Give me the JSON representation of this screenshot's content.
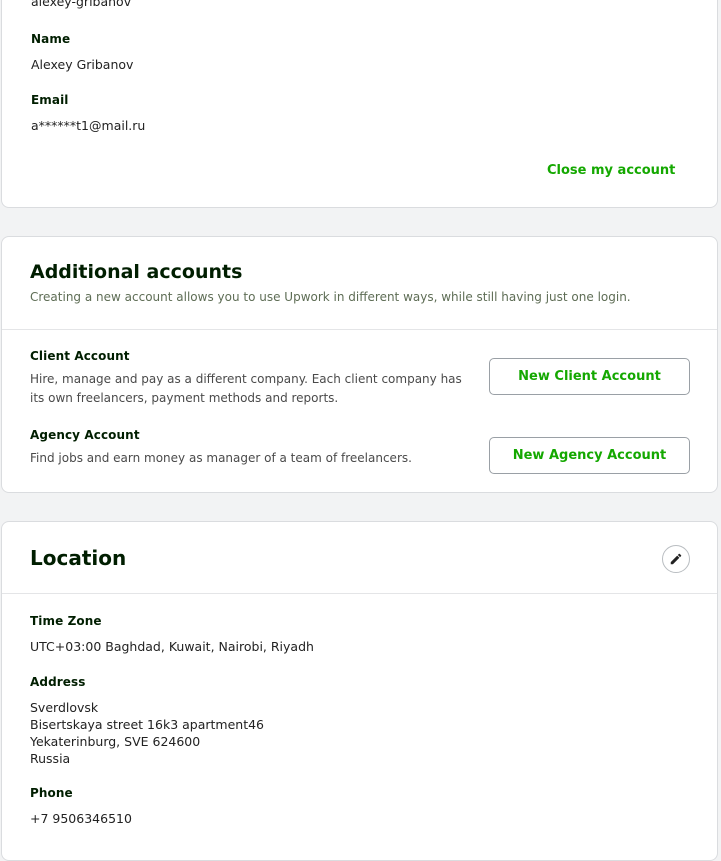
{
  "account": {
    "username": "alexey-gribanov",
    "name_label": "Name",
    "name_value": "Alexey Gribanov",
    "email_label": "Email",
    "email_value": "a******t1@mail.ru",
    "close_link": "Close my account"
  },
  "additional": {
    "title": "Additional accounts",
    "subtitle": "Creating a new account allows you to use Upwork in different ways, while still having just one login.",
    "client": {
      "label": "Client Account",
      "desc": "Hire, manage and pay as a different company. Each client company has its own freelancers, payment methods and reports.",
      "button": "New Client Account"
    },
    "agency": {
      "label": "Agency Account",
      "desc": "Find jobs and earn money as manager of a team of freelancers.",
      "button": "New Agency Account"
    }
  },
  "location": {
    "title": "Location",
    "edit_icon": "pencil-icon",
    "timezone_label": "Time Zone",
    "timezone_value": "UTC+03:00 Baghdad, Kuwait, Nairobi, Riyadh",
    "address_label": "Address",
    "address_lines": [
      "Sverdlovsk",
      "Bisertskaya street 16k3 apartment46",
      "Yekaterinburg, SVE 624600",
      "Russia"
    ],
    "phone_label": "Phone",
    "phone_value": "+7 9506346510"
  },
  "colors": {
    "accent_green": "#14a800",
    "page_bg": "#f2f3f4",
    "card_border": "#dadcdf"
  }
}
